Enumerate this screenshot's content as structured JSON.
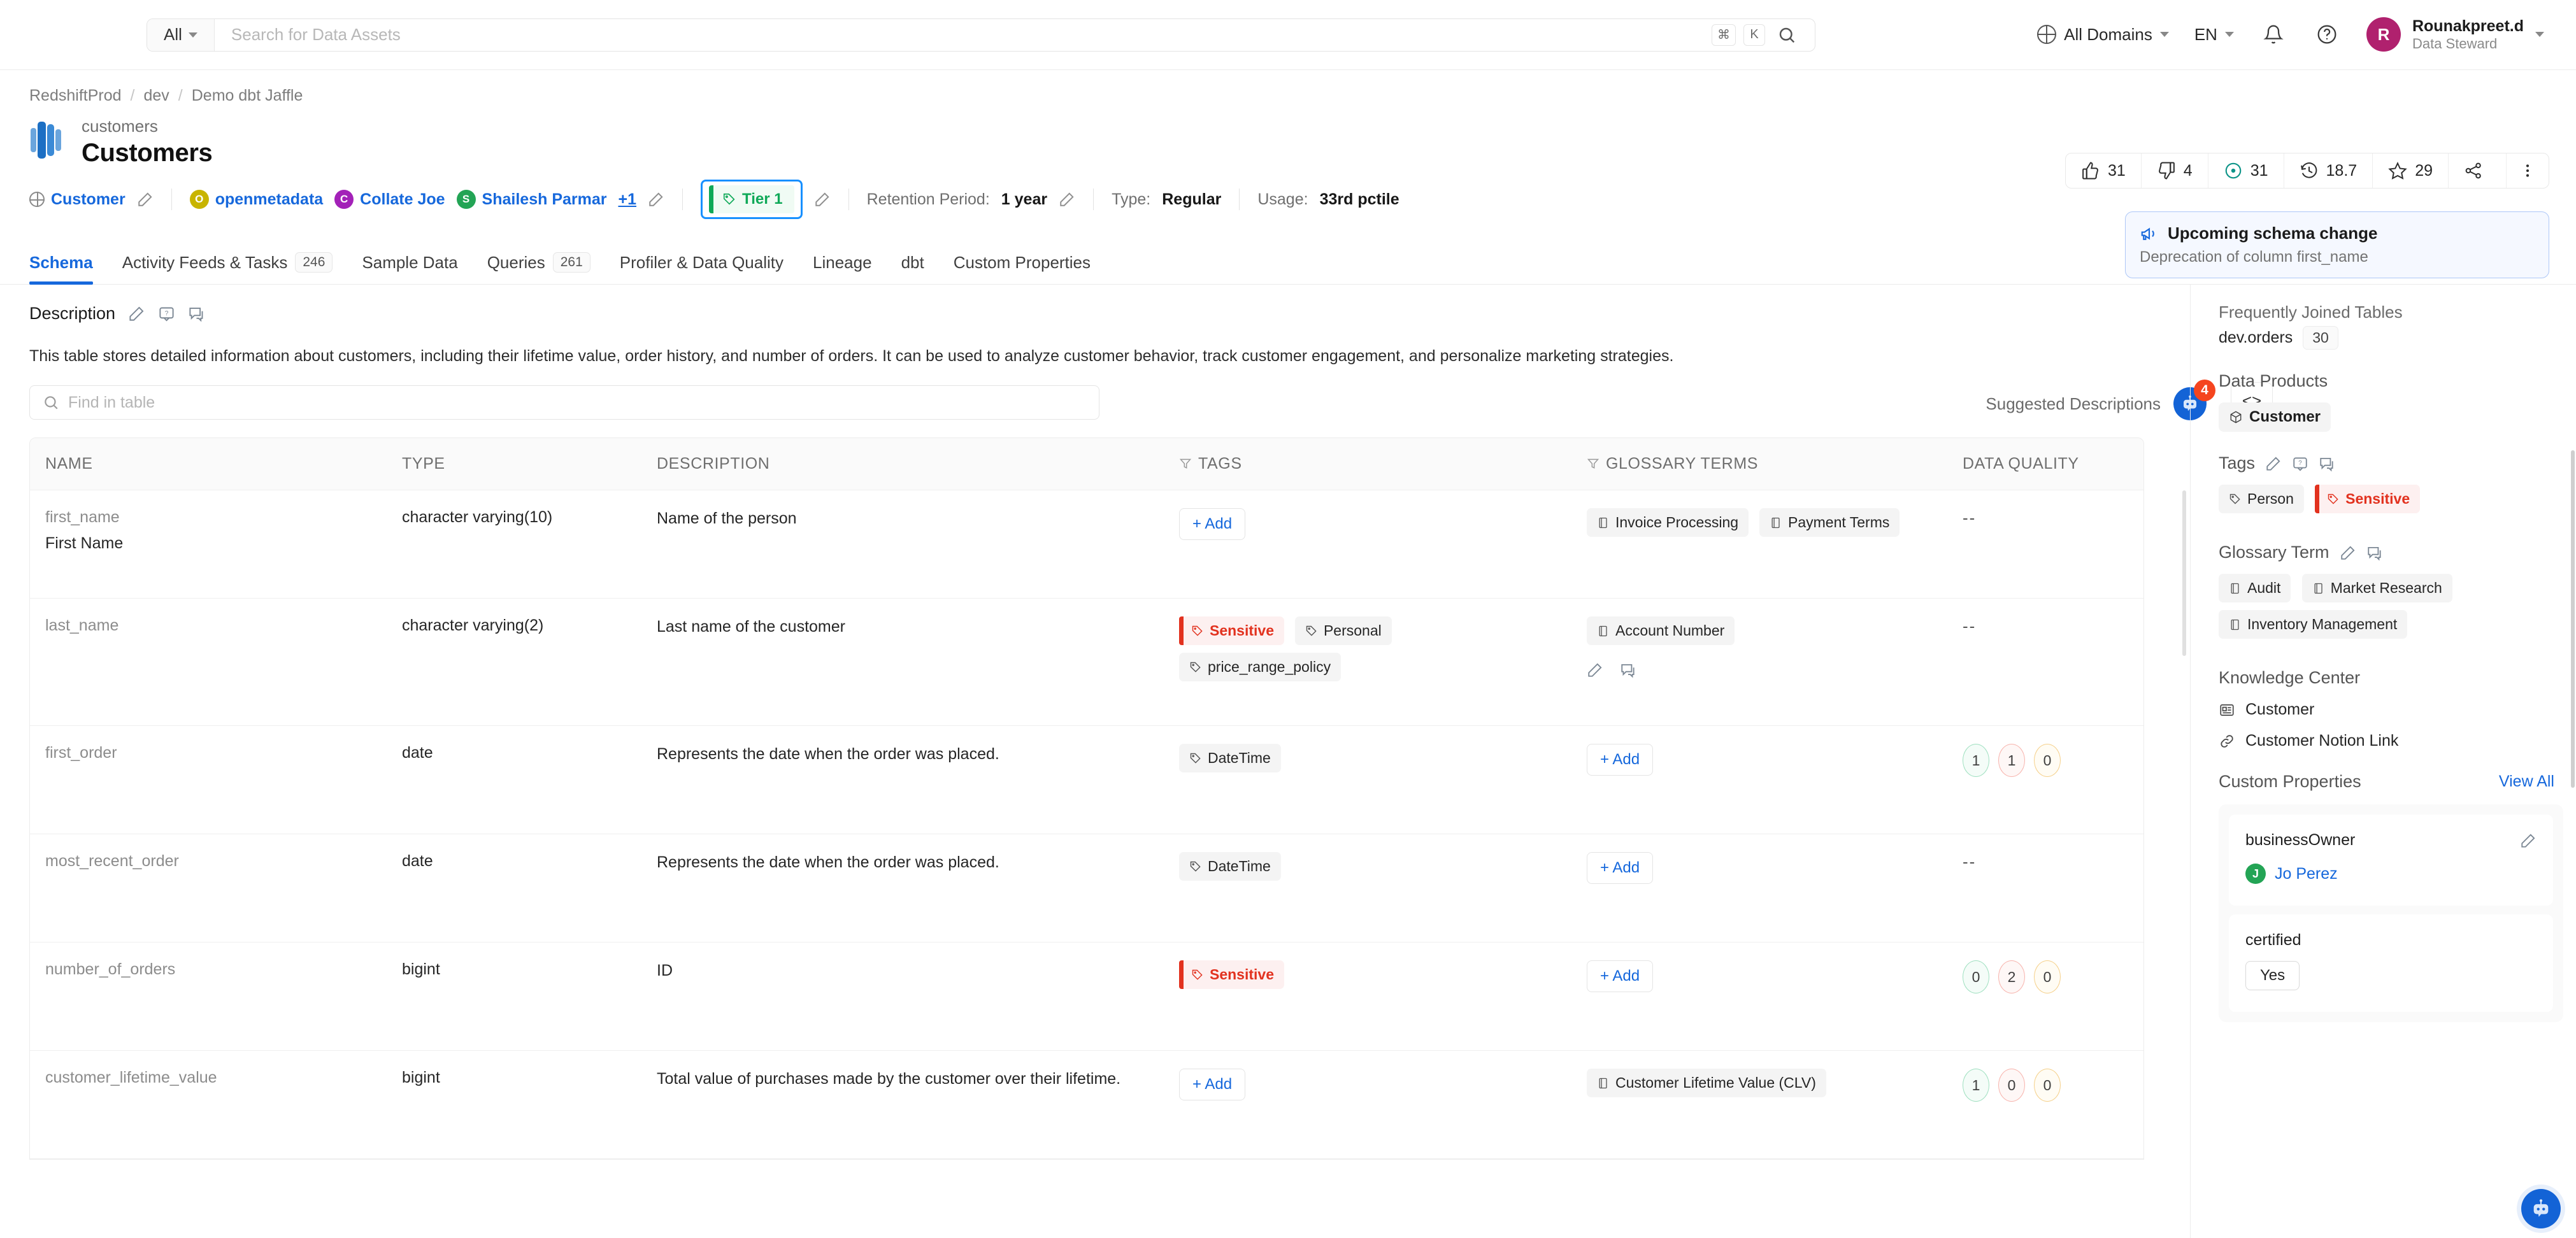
{
  "topbar": {
    "scope_label": "All",
    "search_placeholder": "Search for Data Assets",
    "kbd_cmd": "⌘",
    "kbd_k": "K",
    "search_icon": "search-icon",
    "domains_label": "All Domains",
    "language_label": "EN",
    "bell_icon": "bell-icon",
    "help_icon": "help-circle-icon",
    "user": {
      "initial": "R",
      "name": "Rounakpreet.d",
      "role": "Data Steward",
      "avatar_color": "#b0216e"
    }
  },
  "breadcrumb": {
    "items": [
      "RedshiftProd",
      "dev",
      "Demo dbt Jaffle"
    ]
  },
  "header": {
    "entity_sub": "customers",
    "entity_title": "Customers",
    "domain_label": "Customer",
    "owners": [
      {
        "initial": "O",
        "name": "openmetadata",
        "color": "#c8b400"
      },
      {
        "initial": "C",
        "name": "Collate Joe",
        "color": "#a321b8"
      },
      {
        "initial": "S",
        "name": "Shailesh Parmar",
        "color": "#23a455"
      }
    ],
    "owners_more": "+1",
    "tier_label": "Tier 1",
    "retention_label": "Retention Period:",
    "retention_value": "1 year",
    "type_label": "Type:",
    "type_value": "Regular",
    "usage_label": "Usage:",
    "usage_value": "33rd pctile"
  },
  "stats": [
    {
      "icon": "thumbs-up-icon",
      "value": "31"
    },
    {
      "icon": "thumbs-down-icon",
      "value": "4"
    },
    {
      "icon": "target-icon",
      "value": "31"
    },
    {
      "icon": "history-icon",
      "value": "18.7"
    },
    {
      "icon": "star-icon",
      "value": "29"
    },
    {
      "icon": "share-icon",
      "value": ""
    },
    {
      "icon": "more-vertical-icon",
      "value": ""
    }
  ],
  "notice": {
    "icon": "announcement-icon",
    "title": "Upcoming schema change",
    "subtitle": "Deprecation of column first_name"
  },
  "tabs": [
    {
      "label": "Schema",
      "count": "",
      "active": true
    },
    {
      "label": "Activity Feeds & Tasks",
      "count": "246",
      "active": false
    },
    {
      "label": "Sample Data",
      "count": "",
      "active": false
    },
    {
      "label": "Queries",
      "count": "261",
      "active": false
    },
    {
      "label": "Profiler & Data Quality",
      "count": "",
      "active": false
    },
    {
      "label": "Lineage",
      "count": "",
      "active": false
    },
    {
      "label": "dbt",
      "count": "",
      "active": false
    },
    {
      "label": "Custom Properties",
      "count": "",
      "active": false
    }
  ],
  "description": {
    "label": "Description",
    "text": "This table stores detailed information about customers, including their lifetime value, order history, and number of orders. It can be used to analyze customer behavior, track customer engagement, and personalize marketing strategies.",
    "suggested_label": "Suggested Descriptions",
    "suggested_count": "4",
    "code_icon": "code-brackets-icon"
  },
  "find": {
    "placeholder": "Find in table",
    "icon": "search-icon"
  },
  "table": {
    "headers": [
      "NAME",
      "TYPE",
      "DESCRIPTION",
      "TAGS",
      "GLOSSARY TERMS",
      "DATA QUALITY"
    ],
    "rows": [
      {
        "name": "first_name",
        "display_name": "First Name",
        "type": "character varying(10)",
        "description": "Name of the person",
        "tags": [],
        "tags_add": "+ Add",
        "glossary": [
          "Invoice Processing",
          "Payment Terms"
        ],
        "glossary_add": "",
        "dq": "--",
        "dq_counts": []
      },
      {
        "name": "last_name",
        "display_name": "",
        "type": "character varying(2)",
        "description": "Last name of the customer",
        "tags": [
          "Sensitive",
          "Personal",
          "price_range_policy"
        ],
        "tags_add": "",
        "glossary": [
          "Account Number"
        ],
        "glossary_add": "",
        "dq": "--",
        "dq_counts": []
      },
      {
        "name": "first_order",
        "display_name": "",
        "type": "date",
        "description": "Represents the date when the order was placed.",
        "tags": [
          "DateTime"
        ],
        "tags_add": "",
        "glossary": [],
        "glossary_add": "+ Add",
        "dq": "",
        "dq_counts": [
          "1",
          "1",
          "0"
        ]
      },
      {
        "name": "most_recent_order",
        "display_name": "",
        "type": "date",
        "description": "Represents the date when the order was placed.",
        "tags": [
          "DateTime"
        ],
        "tags_add": "",
        "glossary": [],
        "glossary_add": "+ Add",
        "dq": "--",
        "dq_counts": []
      },
      {
        "name": "number_of_orders",
        "display_name": "",
        "type": "bigint",
        "description": "ID",
        "tags": [
          "Sensitive"
        ],
        "tags_add": "",
        "glossary": [],
        "glossary_add": "+ Add",
        "dq": "",
        "dq_counts": [
          "0",
          "2",
          "0"
        ]
      },
      {
        "name": "customer_lifetime_value",
        "display_name": "",
        "type": "bigint",
        "description": "Total value of purchases made by the customer over their lifetime.",
        "tags": [],
        "tags_add": "+ Add",
        "glossary": [
          "Customer Lifetime Value (CLV)"
        ],
        "glossary_add": "",
        "dq": "",
        "dq_counts": [
          "1",
          "0",
          "0"
        ]
      }
    ]
  },
  "right_panel": {
    "frequently_joined_title": "Frequently Joined Tables",
    "joined": [
      {
        "name": "dev.orders",
        "count": "30"
      }
    ],
    "data_products_title": "Data Products",
    "data_products": [
      "Customer"
    ],
    "tags_title": "Tags",
    "tags": [
      "Person",
      "Sensitive"
    ],
    "glossary_title": "Glossary Term",
    "glossary": [
      "Audit",
      "Market Research",
      "Inventory Management"
    ],
    "knowledge_title": "Knowledge Center",
    "knowledge": [
      {
        "icon": "article-icon",
        "label": "Customer"
      },
      {
        "icon": "link-icon",
        "label": "Customer Notion Link"
      }
    ],
    "custom_props_title": "Custom Properties",
    "view_all": "View All",
    "custom_props": [
      {
        "key": "businessOwner",
        "value_type": "user",
        "user_initial": "J",
        "user_name": "Jo Perez"
      },
      {
        "key": "certified",
        "value_type": "button",
        "value": "Yes"
      }
    ]
  },
  "colors": {
    "accent": "#1668dc",
    "tier_green": "#0fa958",
    "sensitive_red": "#e2321f",
    "badge_orange": "#f5451f",
    "avatar_magenta": "#b0216e"
  }
}
